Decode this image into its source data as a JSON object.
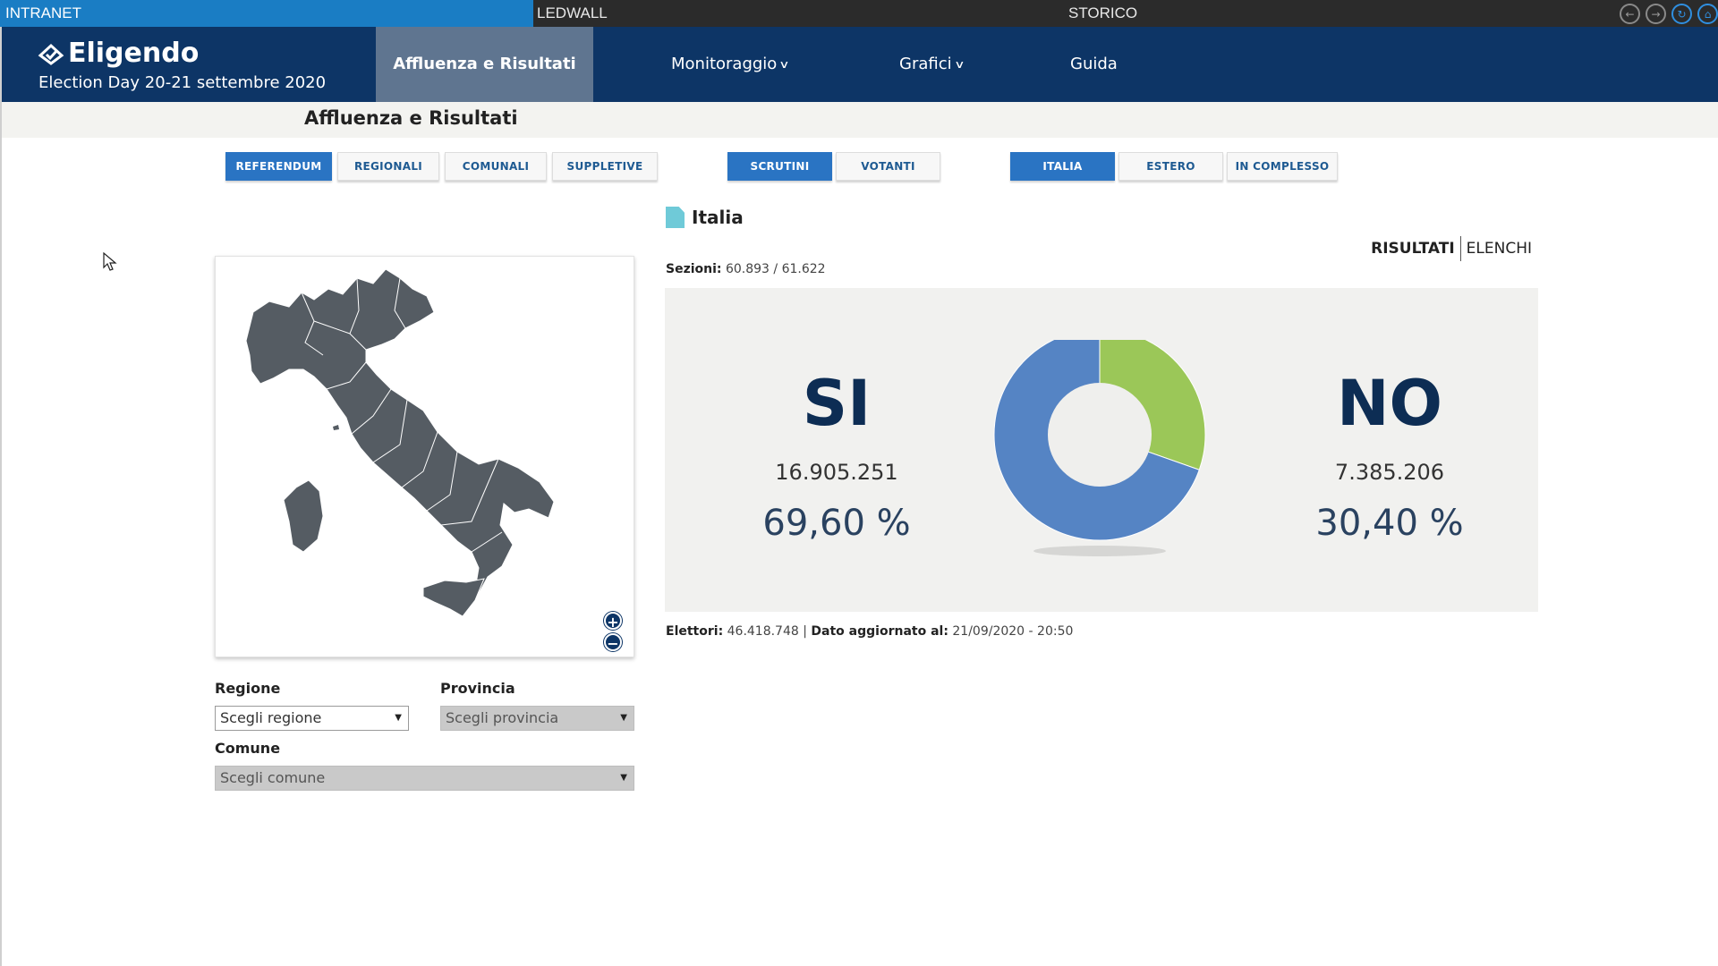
{
  "sysbar": {
    "intranet": "INTRANET",
    "ledwall": "LEDWALL",
    "storico": "STORICO",
    "icons": [
      "back-icon",
      "forward-icon",
      "refresh-icon",
      "home-icon"
    ]
  },
  "header": {
    "logo": "Eligendo",
    "subtitle": "Election Day 20-21 settembre 2020",
    "nav": {
      "affluenza": "Affluenza e Risultati",
      "monitoraggio": "Monitoraggio",
      "grafici": "Grafici",
      "guida": "Guida"
    }
  },
  "page": {
    "title": "Affluenza e Risultati"
  },
  "tabs": {
    "type": [
      "REFERENDUM",
      "REGIONALI",
      "COMUNALI",
      "SUPPLETIVE"
    ],
    "mode": [
      "SCRUTINI",
      "VOTANTI"
    ],
    "scope": [
      "ITALIA",
      "ESTERO",
      "IN COMPLESSO"
    ],
    "active": {
      "type": "REFERENDUM",
      "mode": "SCRUTINI",
      "scope": "ITALIA"
    }
  },
  "filters": {
    "regione_label": "Regione",
    "regione_value": "Scegli regione",
    "provincia_label": "Provincia",
    "provincia_value": "Scegli provincia",
    "comune_label": "Comune",
    "comune_value": "Scegli comune"
  },
  "results": {
    "area": "Italia",
    "toggle": {
      "risultati": "RISULTATI",
      "elenchi": "ELENCHI"
    },
    "sezioni_label": "Sezioni:",
    "sezioni_value": "60.893 / 61.622",
    "yes": {
      "label": "SI",
      "votes": "16.905.251",
      "percent": "69,60 %"
    },
    "no": {
      "label": "NO",
      "votes": "7.385.206",
      "percent": "30,40 %"
    },
    "elettori_label": "Elettori:",
    "elettori_value": "46.418.748",
    "updated_label": "Dato aggiornato al:",
    "updated_value": "21/09/2020 - 20:50",
    "colors": {
      "yes": "#5584c4",
      "no": "#9bc758"
    }
  },
  "chart_data": {
    "type": "pie",
    "categories": [
      "SI",
      "NO"
    ],
    "values": [
      69.6,
      30.4
    ],
    "title": ""
  },
  "colors": {
    "accent": "#2a74c3",
    "header": "#0d3566",
    "intranet": "#1a7dc4"
  }
}
